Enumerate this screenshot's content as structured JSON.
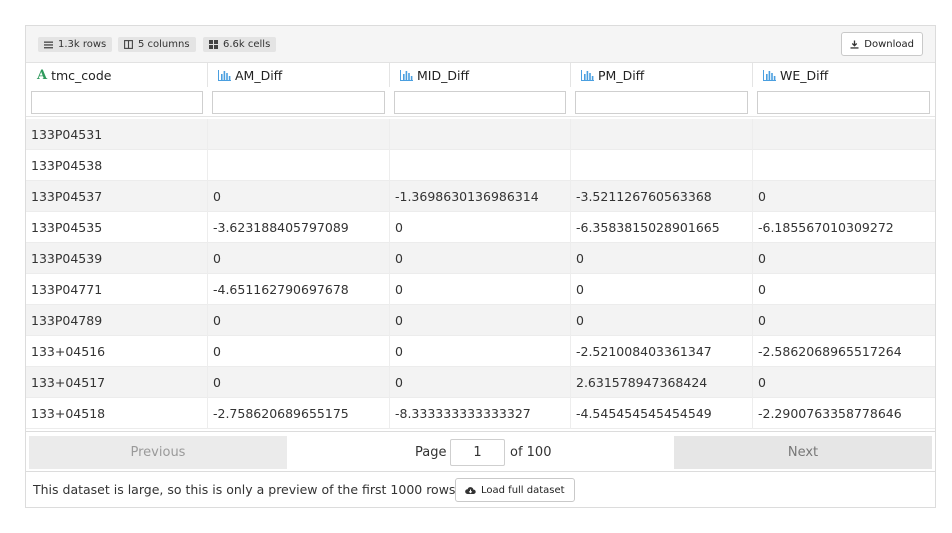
{
  "toolbar": {
    "rows_label": "1.3k rows",
    "columns_label": "5 columns",
    "cells_label": "6.6k cells",
    "download_label": "Download"
  },
  "columns": [
    {
      "name": "tmc_code",
      "type_icon": "text-type-icon"
    },
    {
      "name": "AM_Diff",
      "type_icon": "histogram-icon"
    },
    {
      "name": "MID_Diff",
      "type_icon": "histogram-icon"
    },
    {
      "name": "PM_Diff",
      "type_icon": "histogram-icon"
    },
    {
      "name": "WE_Diff",
      "type_icon": "histogram-icon"
    }
  ],
  "rows": [
    [
      "133P04531",
      "",
      "",
      "",
      ""
    ],
    [
      "133P04538",
      "",
      "",
      "",
      ""
    ],
    [
      "133P04537",
      "0",
      "-1.3698630136986314",
      "-3.521126760563368",
      "0"
    ],
    [
      "133P04535",
      "-3.623188405797089",
      "0",
      "-6.3583815028901665",
      "-6.185567010309272"
    ],
    [
      "133P04539",
      "0",
      "0",
      "0",
      "0"
    ],
    [
      "133P04771",
      "-4.651162790697678",
      "0",
      "0",
      "0"
    ],
    [
      "133P04789",
      "0",
      "0",
      "0",
      "0"
    ],
    [
      "133+04516",
      "0",
      "0",
      "-2.521008403361347",
      "-2.5862068965517264"
    ],
    [
      "133+04517",
      "0",
      "0",
      "2.631578947368424",
      "0"
    ],
    [
      "133+04518",
      "-2.758620689655175",
      "-8.333333333333327",
      "-4.545454545454549",
      "-2.2900763358778646"
    ]
  ],
  "pager": {
    "previous_label": "Previous",
    "page_label": "Page",
    "page_value": "1",
    "of_label": "of 100",
    "next_label": "Next"
  },
  "footer": {
    "notice": "This dataset is large, so this is only a preview of the first 1000 rows.",
    "load_label": "Load full dataset"
  },
  "colors": {
    "accent_icon": "#4a9fe0",
    "text_type_icon": "#2e9a5c"
  }
}
